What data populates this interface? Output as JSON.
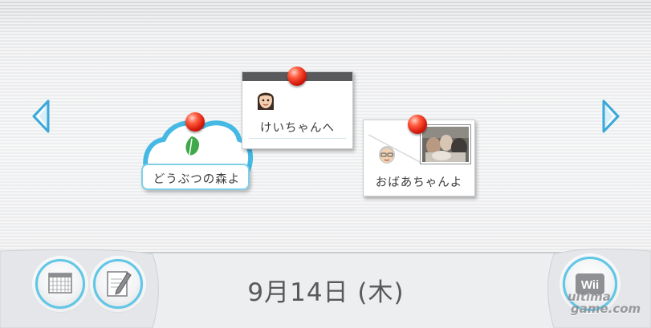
{
  "board": {
    "messages": [
      {
        "label": "どうぶつの森よ",
        "icon": "leaf-icon"
      },
      {
        "label": "けいちゃんへ",
        "icon": "mii-avatar"
      },
      {
        "label": "おばあちゃんよ",
        "icon": "mii-avatar-with-photo"
      }
    ]
  },
  "navigation": {
    "left_icon": "arrow-left-icon",
    "right_icon": "arrow-right-icon"
  },
  "footer": {
    "date": "9月14日 (木)",
    "wii_button_label": "Wii",
    "watermark_line1": "ultima",
    "watermark_line2": "game.com"
  },
  "colors": {
    "accent": "#5ec6e6",
    "arrow": "#3aa8d8",
    "pin": "#d4190c",
    "text": "#58595b"
  }
}
